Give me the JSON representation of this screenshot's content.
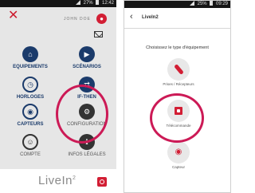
{
  "left_screen": {
    "status_bar": {
      "battery": "27%",
      "time": "12:42"
    },
    "header": {
      "user_name": "JOHN DOE"
    },
    "menu": [
      {
        "label": "EQUIPEMENTS",
        "icon": "home-icon"
      },
      {
        "label": "SCÉNARIOS",
        "icon": "play-icon"
      },
      {
        "label": "HORLOGES",
        "icon": "clock-icon"
      },
      {
        "label": "IF-THEN",
        "icon": "arrows-icon"
      },
      {
        "label": "CAPTEURS",
        "icon": "eye-icon"
      },
      {
        "label": "CONFIGURATION",
        "icon": "gear-icon"
      },
      {
        "label": "COMPTE",
        "icon": "user-icon"
      },
      {
        "label": "INFOS LÉGALES",
        "icon": "info-icon"
      }
    ],
    "footer": {
      "logo_text": "LiveIn",
      "logo_superscript": "2"
    }
  },
  "right_screen": {
    "status_bar": {
      "battery": "25%",
      "time": "09:29"
    },
    "nav": {
      "title": "LiveIn2"
    },
    "prompt": "Choisissez le type d'équipement",
    "options": [
      {
        "label": "Prises / Récepteurs",
        "icon": "plug-icon"
      },
      {
        "label": "Télécommande",
        "icon": "remote-icon"
      },
      {
        "label": "Capteur",
        "icon": "eye-icon"
      }
    ]
  },
  "colors": {
    "accent": "#d21e34",
    "primary": "#1b3b6b",
    "highlight": "#cc1a56"
  }
}
